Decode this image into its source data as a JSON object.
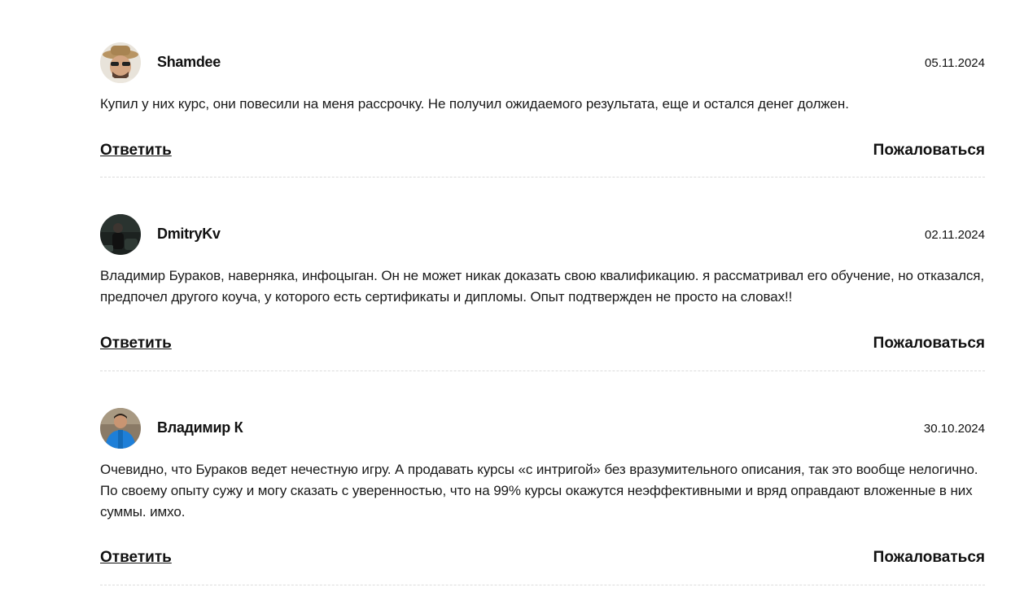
{
  "comments": [
    {
      "author": "Shamdee",
      "date": "05.11.2024",
      "text": "Купил у них курс, они повесили на меня рассрочку. Не получил ожидаемого результата, еще и остался денег должен.",
      "reply_label": "Ответить",
      "report_label": "Пожаловаться",
      "avatar_icon": "avatar-man-with-hat-icon"
    },
    {
      "author": "DmitryKv",
      "date": "02.11.2024",
      "text": "Владимир Бураков, наверняка, инфоцыган. Он не может никак доказать свою квалификацию. я рассматривал его обучение, но отказался, предпочел другого коуча, у которого есть сертификаты и дипломы. Опыт подтвержден не просто на словах!!",
      "reply_label": "Ответить",
      "report_label": "Пожаловаться",
      "avatar_icon": "avatar-dark-photo-icon"
    },
    {
      "author": "Владимир К",
      "date": "30.10.2024",
      "text": "Очевидно, что Бураков ведет нечестную игру. А продавать курсы «с интригой» без вразумительного описания, так это вообще нелогично. По своему опыту сужу и могу сказать с уверенностью, что на 99% курсы окажутся неэффективными и вряд оправдают вложенные в них суммы. имхо.",
      "reply_label": "Ответить",
      "report_label": "Пожаловаться",
      "avatar_icon": "avatar-man-blue-jacket-icon"
    }
  ],
  "colors": {
    "text": "#111111",
    "divider": "#dcdcdc",
    "background": "#ffffff"
  }
}
